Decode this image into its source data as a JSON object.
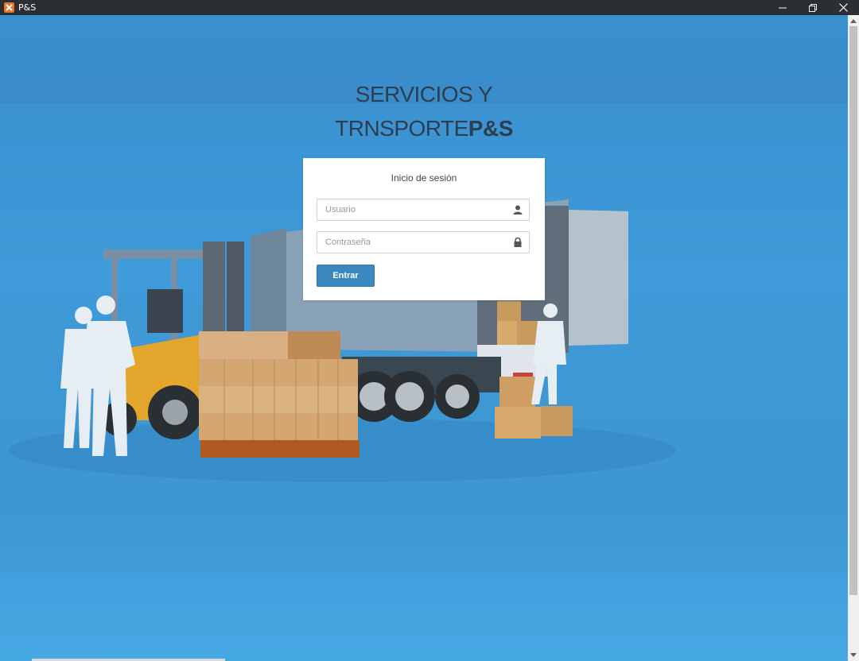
{
  "window": {
    "title": "P&S",
    "icon": "xampp-icon",
    "controls": [
      "minimize-icon",
      "restore-icon",
      "close-icon"
    ]
  },
  "page": {
    "heading_line1": "SERVICIOS Y",
    "heading_line2": "TRNSPORTE",
    "heading_brand": "P&S"
  },
  "login": {
    "title": "Inicio de sesión",
    "username_placeholder": "Usuario",
    "password_placeholder": "Contraseña",
    "submit_label": "Entrar",
    "username_icon": "user-icon",
    "password_icon": "lock-icon"
  },
  "colors": {
    "background": "#3d96d3",
    "button": "#3a88bf",
    "heading": "#2d3e50",
    "titlebar": "#2b2e33"
  }
}
